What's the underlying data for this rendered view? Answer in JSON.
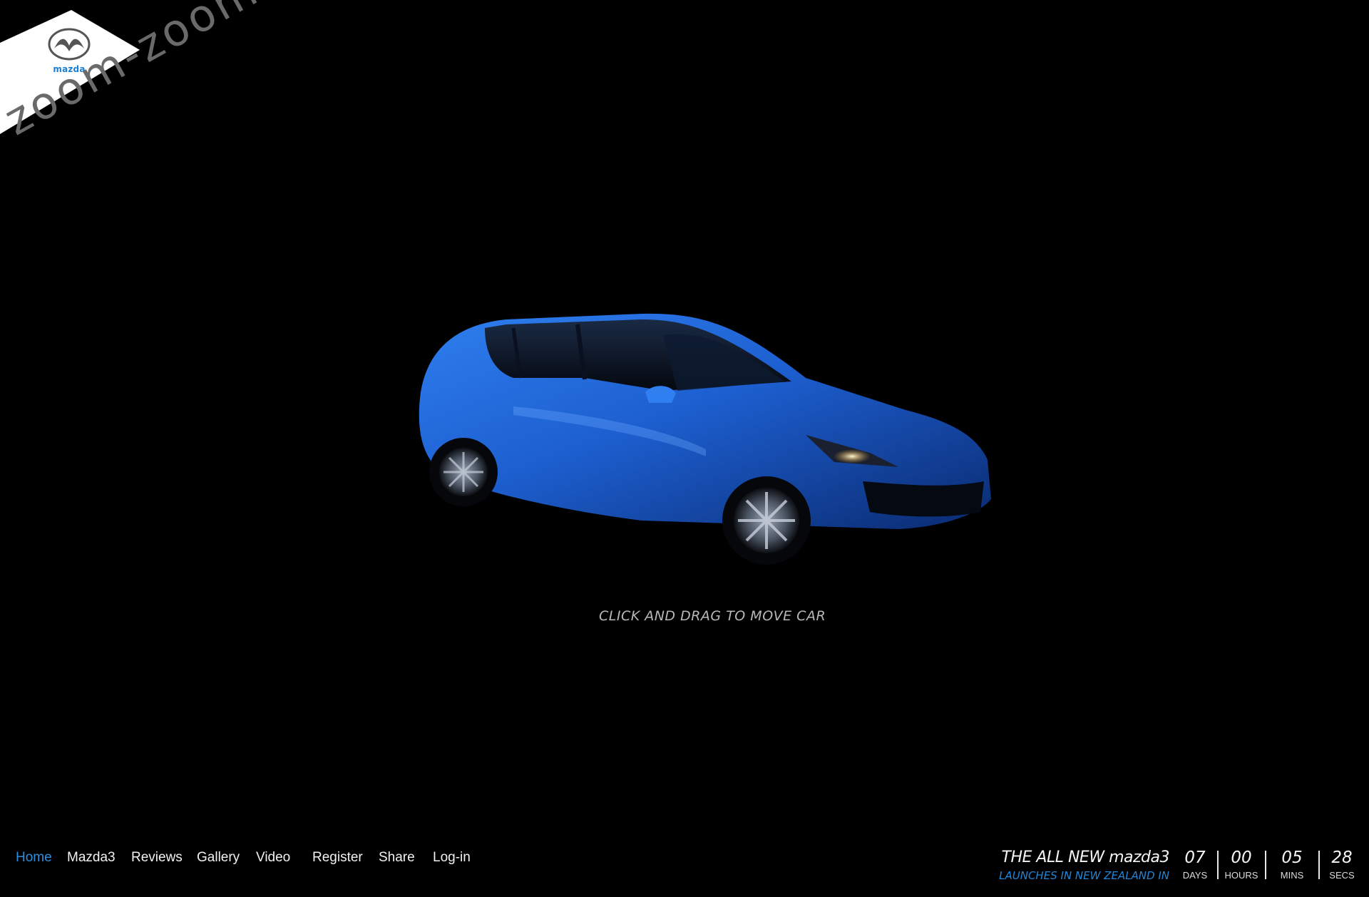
{
  "brand": {
    "logo_text": "mazda",
    "tagline": "zoom-zoom",
    "logo_icon": "mazda-logo-icon"
  },
  "stage": {
    "car_color": "#1d5fd0",
    "hint": "CLICK AND DRAG TO MOVE CAR"
  },
  "nav": {
    "items": [
      {
        "label": "Home",
        "active": true
      },
      {
        "label": "Mazda3",
        "active": false
      },
      {
        "label": "Reviews",
        "active": false
      },
      {
        "label": "Gallery",
        "active": false
      },
      {
        "label": "Video",
        "active": false
      },
      {
        "label": "Register",
        "active": false
      },
      {
        "label": "Share",
        "active": false
      },
      {
        "label": "Log-in",
        "active": false
      }
    ],
    "active_color": "#2a8fe0"
  },
  "launch": {
    "title": "THE ALL NEW mazda3",
    "subtitle": "LAUNCHES IN NEW ZEALAND IN",
    "countdown": [
      {
        "value": "07",
        "unit": "DAYS"
      },
      {
        "value": "00",
        "unit": "HOURS"
      },
      {
        "value": "05",
        "unit": "MINS"
      },
      {
        "value": "28",
        "unit": "SECS"
      }
    ]
  }
}
